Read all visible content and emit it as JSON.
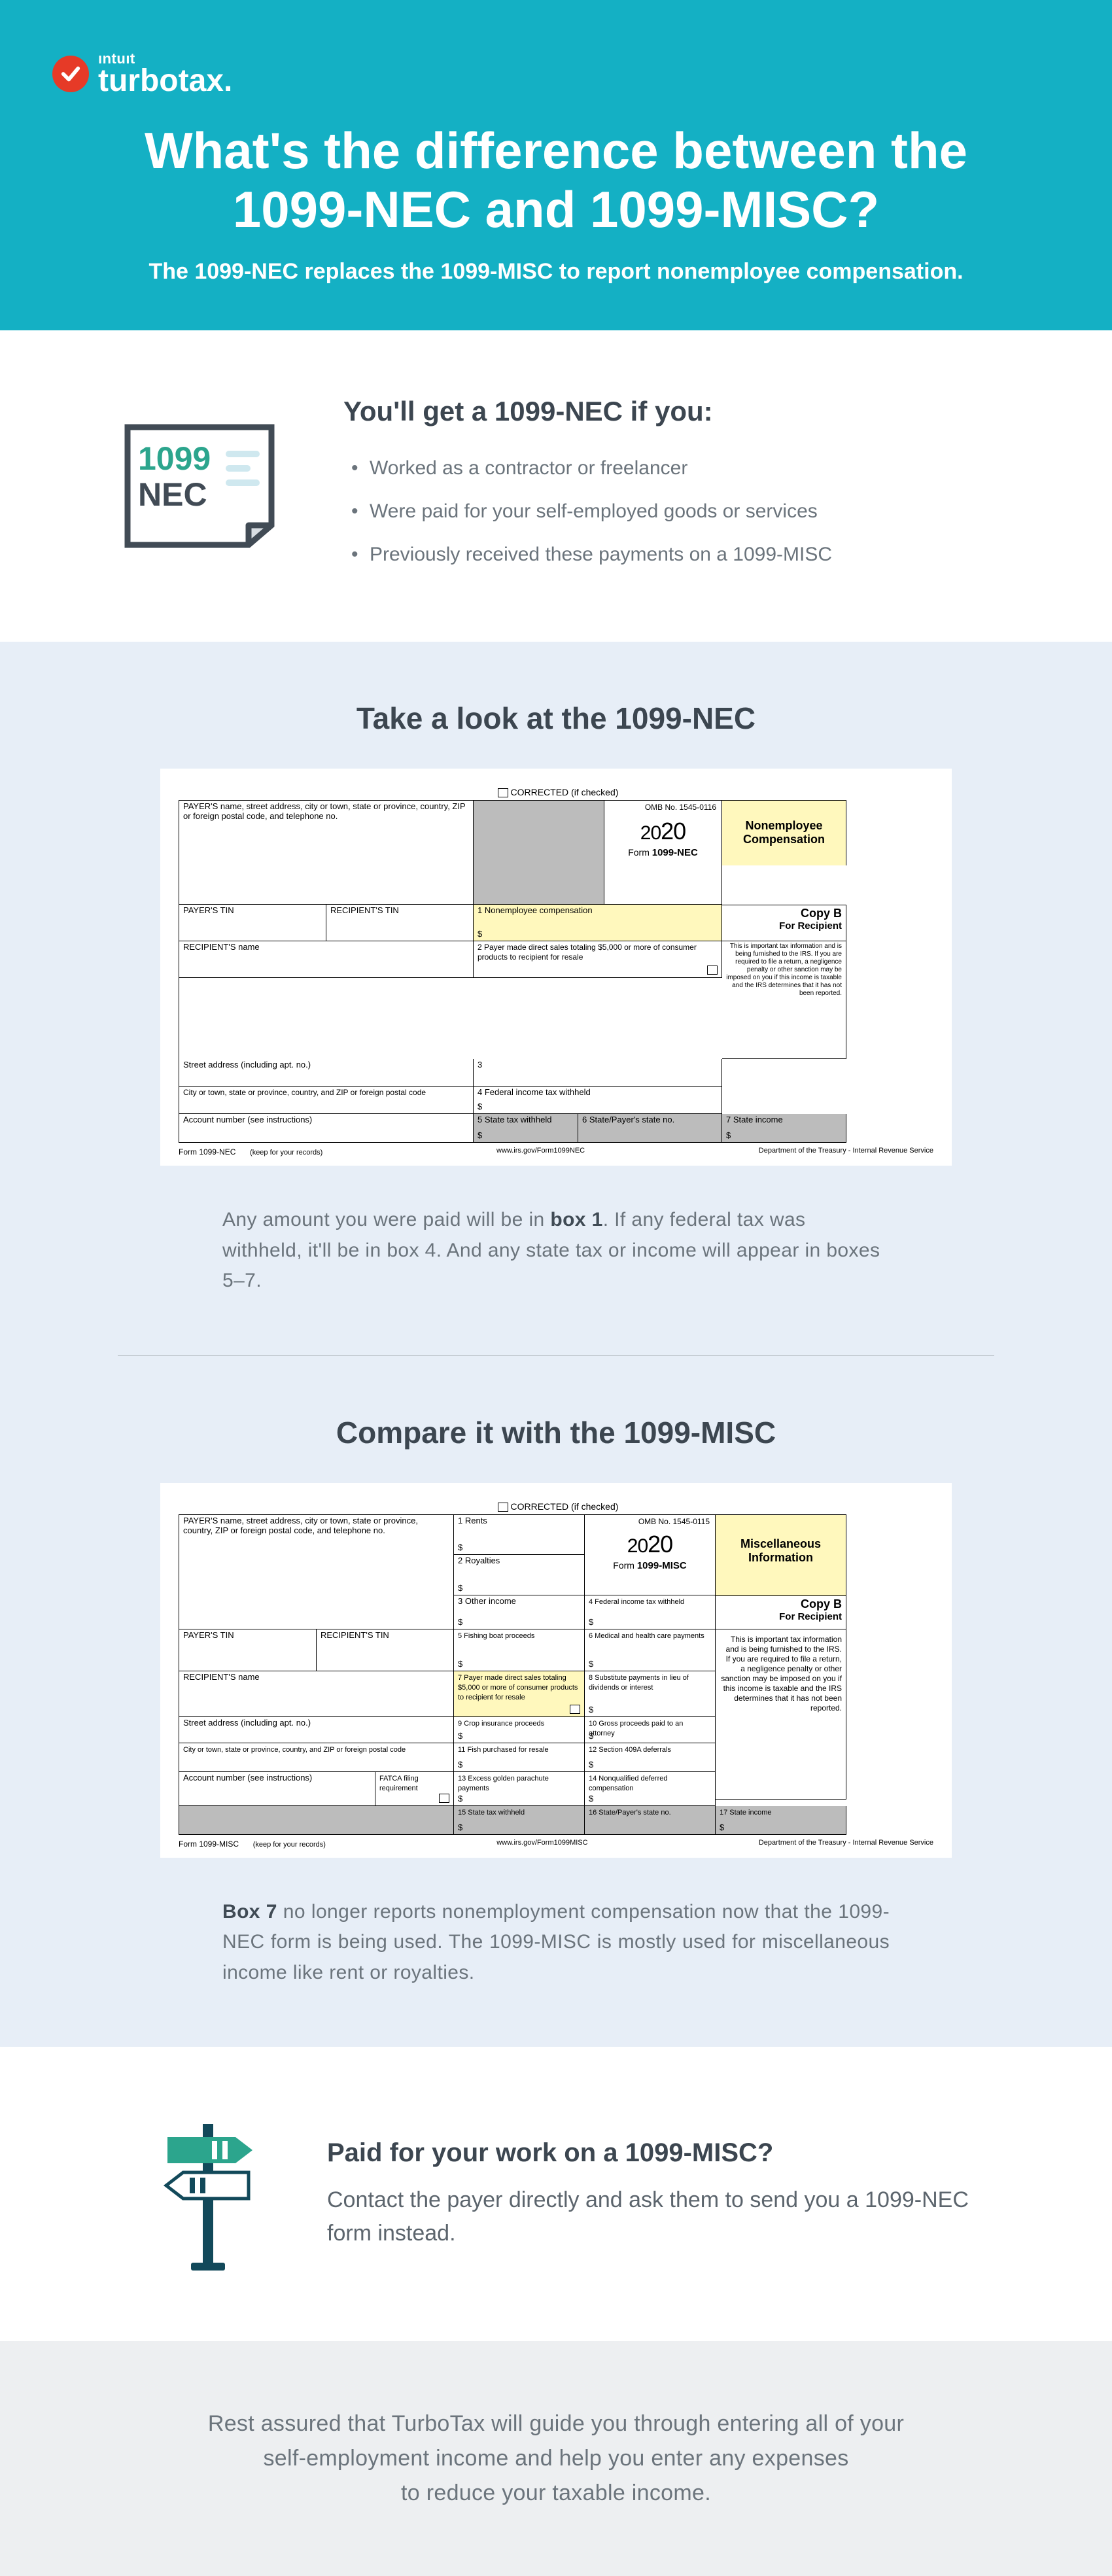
{
  "logo": {
    "intuit": "ıntuıt",
    "brand": "turbotax",
    "dot": "."
  },
  "header": {
    "title_line1": "What's the difference between the",
    "title_line2": "1099-NEC and 1099-MISC?",
    "subhead": "The 1099-NEC replaces the 1099-MISC to report nonemployee compensation."
  },
  "docIcon": {
    "line1": "1099",
    "line2": "NEC"
  },
  "necIntro": {
    "heading": "You'll get a 1099-NEC if you:",
    "items": [
      "Worked as a contractor or freelancer",
      "Were paid for your self-employed goods or services",
      "Previously received these payments on a 1099-MISC"
    ]
  },
  "necSection": {
    "heading": "Take a look at the 1099-NEC",
    "form": {
      "corrected": "CORRECTED (if checked)",
      "payerBlock": "PAYER'S name, street address, city or town, state or province, country, ZIP or foreign postal code, and telephone no.",
      "omb": "OMB No. 1545-0116",
      "year_a": "20",
      "year_b": "20",
      "formline": "Form ",
      "formname": "1099-NEC",
      "sideLabel": "Nonemployee Compensation",
      "payerTin": "PAYER'S TIN",
      "recipTin": "RECIPIENT'S TIN",
      "box1": "1 Nonemployee compensation",
      "box2": "2 Payer made direct sales totaling $5,000 or more of consumer products to recipient for resale",
      "box3": "3",
      "box4": "4 Federal income tax withheld",
      "box5": "5 State tax withheld",
      "box6": "6 State/Payer's state no.",
      "box7": "7 State income",
      "recipName": "RECIPIENT'S name",
      "street": "Street address (including apt. no.)",
      "cityline": "City or town, state or province, country, and ZIP or foreign postal code",
      "acct": "Account number (see instructions)",
      "copyB": "Copy B",
      "forRecip": "For Recipient",
      "sideText": "This is important tax information and is being furnished to the IRS. If you are required to file a return, a negligence penalty or other sanction may be imposed on you if this income is taxable and the IRS determines that it has not been reported.",
      "footerL": "Form 1099-NEC",
      "footerKeep": "(keep for your records)",
      "footerM": "www.irs.gov/Form1099NEC",
      "footerR": "Department of the Treasury - Internal Revenue Service",
      "dollar": "$"
    },
    "caption_a": "Any amount you were paid will be in ",
    "caption_bold": "box 1",
    "caption_b": ". If any federal tax was withheld, it'll be in box 4. And any state tax or income will appear in boxes 5–7."
  },
  "miscSection": {
    "heading": "Compare it with the 1099-MISC",
    "form": {
      "corrected": "CORRECTED (if checked)",
      "payerBlock": "PAYER'S name, street address, city or town, state or province, country, ZIP or foreign postal code, and telephone no.",
      "omb": "OMB No. 1545-0115",
      "year_a": "20",
      "year_b": "20",
      "formline": "Form ",
      "formname": "1099-MISC",
      "sideLabel": "Miscellaneous Information",
      "box1": "1 Rents",
      "box2": "2 Royalties",
      "box3": "3 Other income",
      "box4": "4 Federal income tax withheld",
      "box5": "5 Fishing boat proceeds",
      "box6": "6 Medical and health care payments",
      "box7": "7 Payer made direct sales totaling $5,000 or more of consumer products to recipient for resale",
      "box8": "8 Substitute payments in lieu of dividends or interest",
      "box9": "9 Crop insurance proceeds",
      "box10": "10 Gross proceeds paid to an attorney",
      "box11": "11 Fish purchased for resale",
      "box12": "12 Section 409A deferrals",
      "box13": "13 Excess golden parachute payments",
      "box14": "14 Nonqualified deferred compensation",
      "box15": "15 State tax withheld",
      "box16": "16 State/Payer's state no.",
      "box17": "17 State income",
      "payerTin": "PAYER'S TIN",
      "recipTin": "RECIPIENT'S TIN",
      "recipName": "RECIPIENT'S name",
      "street": "Street address (including apt. no.)",
      "cityline": "City or town, state or province, country, and ZIP or foreign postal code",
      "acct": "Account number (see instructions)",
      "fatca": "FATCA filing requirement",
      "copyB": "Copy B",
      "forRecip": "For Recipient",
      "sideText": "This is important tax information and is being furnished to the IRS. If you are required to file a return, a negligence penalty or other sanction may be imposed on you if this income is taxable and the IRS determines that it has not been reported.",
      "footerL": "Form 1099-MISC",
      "footerKeep": "(keep for your records)",
      "footerM": "www.irs.gov/Form1099MISC",
      "footerR": "Department of the Treasury - Internal Revenue Service",
      "dollar": "$"
    },
    "caption_bold": "Box 7",
    "caption_a": " no longer reports nonemployment compensation now that the 1099-NEC form is being used. The 1099-MISC is mostly used for miscellaneous income like rent or royalties."
  },
  "paid": {
    "heading": "Paid for your work on a 1099-MISC?",
    "body": "Contact the payer directly and ask them to send you a 1099-NEC form instead."
  },
  "rest": {
    "l1": "Rest assured that TurboTax will guide you through entering all of your",
    "l2": "self-employment income and help you enter any expenses",
    "l3": "to reduce your taxable income."
  }
}
